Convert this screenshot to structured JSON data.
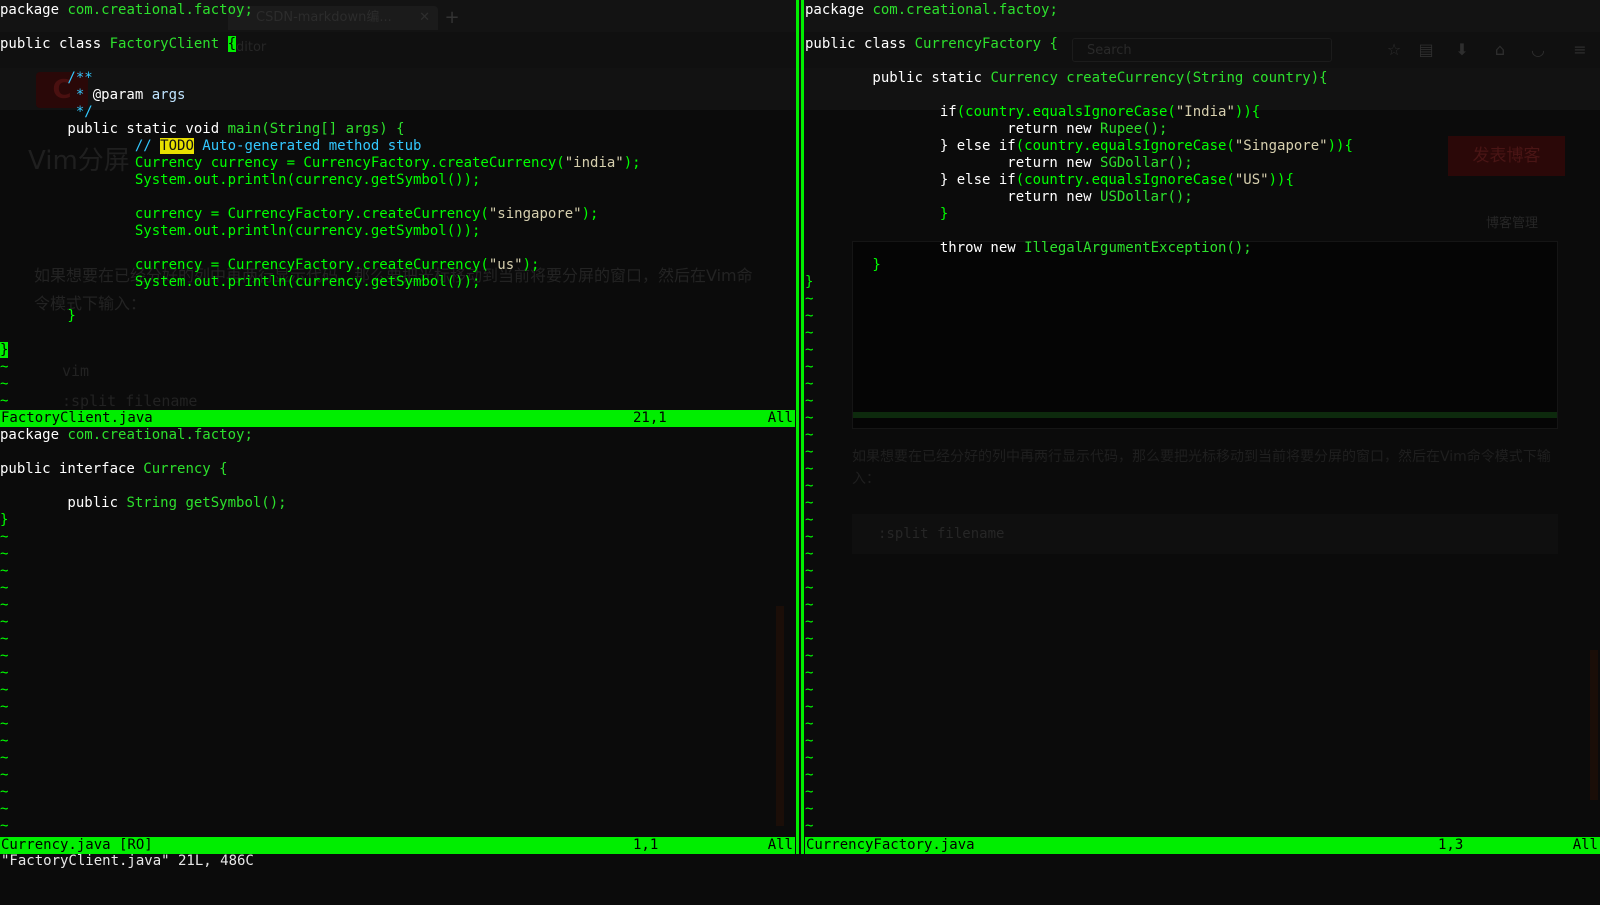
{
  "background_page": {
    "tab_title": "CSDN-markdown编...",
    "new_tab": "+",
    "url_fragment": "editor",
    "search_placeholder": "Search",
    "logo": "C",
    "heading": "Vim分屏",
    "publish_button": "发表博客",
    "manage_link": "博客管理",
    "paragraph1": "如果想要在已经分好的列中再两行显示代码，那么要把光标移动到当前将要分屏的窗口，然后在Vim命令模式下输入：",
    "code1_line1": "vim",
    "code1_line2": ":split filename",
    "paragraph2": "如果想要在已经分好的列中再两行显示代码，那么要把光标移动到当前将要分屏的窗口，然后在Vim命令模式下输入：",
    "code2": ":split filename"
  },
  "windows": {
    "factory_client": {
      "lines": {
        "l1a": "package ",
        "l1b": "com.creational.factoy;",
        "l2a": "public class ",
        "l2b": "FactoryClient ",
        "l2c": "{",
        "l3": "        /**",
        "l4a": "         * ",
        "l4b": "@param",
        "l4c": " args",
        "l5": "         */",
        "l6a": "        public static void ",
        "l6b": "main(String[] args) {",
        "l7a": "                // ",
        "l7b": "TODO",
        "l7c": " Auto-generated method stub",
        "l8a": "                Currency currency = CurrencyFactory.createCurrency(",
        "l8b": "\"india\"",
        "l8c": ");",
        "l9": "                System.out.println(currency.getSymbol());",
        "l10a": "                currency = CurrencyFactory.createCurrency(",
        "l10b": "\"singapore\"",
        "l10c": ");",
        "l11": "                System.out.println(currency.getSymbol());",
        "l12a": "                currency = CurrencyFactory.createCurrency(",
        "l12b": "\"us\"",
        "l12c": ");",
        "l13": "                System.out.println(currency.getSymbol());",
        "l14": "        }",
        "l15": "}"
      },
      "status": {
        "filename": "FactoryClient.java",
        "position": "21,1",
        "scroll": "All"
      }
    },
    "currency": {
      "lines": {
        "l1a": "package ",
        "l1b": "com.creational.factoy;",
        "l2a": "public interface ",
        "l2b": "Currency {",
        "l3a": "        public ",
        "l3b": "String getSymbol();",
        "l4": "}"
      },
      "status": {
        "filename": "Currency.java [RO]",
        "position": "1,1",
        "scroll": "All"
      }
    },
    "currency_factory": {
      "lines": {
        "l1a": "package ",
        "l1b": "com.creational.factoy;",
        "l2a": "public class ",
        "l2b": "CurrencyFactory {",
        "l3a": "        public static ",
        "l3b": "Currency createCurrency(String country){",
        "l4a": "                if",
        "l4b": "(country.equalsIgnoreCase(",
        "l4c": "\"India\"",
        "l4d": ")){",
        "l5a": "                        return new ",
        "l5b": "Rupee();",
        "l6a": "                } else if",
        "l6b": "(country.equalsIgnoreCase(",
        "l6c": "\"Singapore\"",
        "l6d": ")){",
        "l7a": "                        return new ",
        "l7b": "SGDollar();",
        "l8a": "                } else if",
        "l8b": "(country.equalsIgnoreCase(",
        "l8c": "\"US\"",
        "l8d": ")){",
        "l9a": "                        return new ",
        "l9b": "USDollar();",
        "l10": "                }",
        "l11a": "                throw new ",
        "l11b": "IllegalArgumentException();",
        "l12": "        }",
        "l13": "}"
      },
      "status": {
        "filename": "CurrencyFactory.java",
        "position": "1,3",
        "scroll": "All"
      }
    }
  },
  "tilde": "~",
  "command_line": "\"FactoryClient.java\" 21L, 486C",
  "colors": {
    "statusline": "#00ee00",
    "code_text": "#00ff00",
    "keyword": "#ffffff",
    "string": "#d6cfae",
    "comment": "#33c8ff",
    "todo_highlight": "#e8e000"
  }
}
